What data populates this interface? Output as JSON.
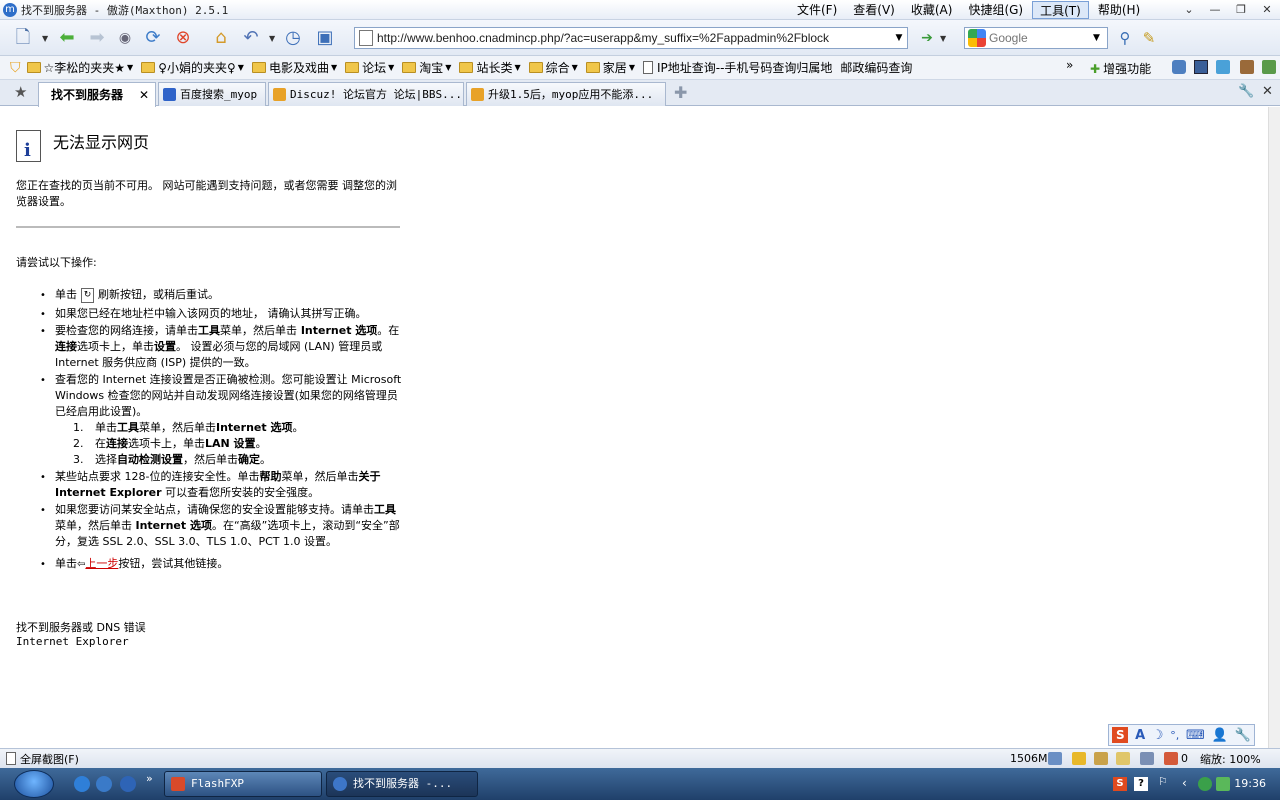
{
  "window": {
    "title": "找不到服务器 - 傲游(Maxthon) 2.5.1",
    "menu": [
      "文件(F)",
      "查看(V)",
      "收藏(A)",
      "快捷组(G)",
      "工具(T)",
      "帮助(H)"
    ],
    "active_menu": "工具(T)"
  },
  "toolbar": {
    "address": "http://www.benhoo.cnadmincp.php/?ac=userapp&my_suffix=%2Fappadmin%2Fblock",
    "search_placeholder": "Google"
  },
  "favorites": [
    {
      "label": "☆李松的夹夹★",
      "type": "folder"
    },
    {
      "label": "♀小娟的夹夹♀",
      "type": "folder"
    },
    {
      "label": "电影及戏曲",
      "type": "folder"
    },
    {
      "label": "论坛",
      "type": "folder"
    },
    {
      "label": "淘宝",
      "type": "folder"
    },
    {
      "label": "站长类",
      "type": "folder"
    },
    {
      "label": "综合",
      "type": "folder"
    },
    {
      "label": "家居",
      "type": "folder"
    },
    {
      "label": "IP地址查询--手机号码查询归属地",
      "type": "page"
    },
    {
      "label": "邮政编码查询",
      "type": "link"
    }
  ],
  "favorites_right": {
    "enhance": "增强功能"
  },
  "tabs": [
    {
      "label": "找不到服务器",
      "active": true
    },
    {
      "label": "百度搜索_myop",
      "active": false
    },
    {
      "label": "Discuz! 论坛官方 论坛|BBS...",
      "active": false
    },
    {
      "label": "升级1.5后，myop应用不能添...",
      "active": false
    }
  ],
  "page": {
    "title": "无法显示网页",
    "description": "您正在查找的页当前不可用。 网站可能遇到支持问题，或者您需要 调整您的浏览器设置。",
    "try_title": "请尝试以下操作:",
    "step1_prefix": "单击",
    "step1_suffix": "刷新按钮，或稍后重试。",
    "step2": "如果您已经在地址栏中输入该网页的地址， 请确认其拼写正确。",
    "step3_a": "要检查您的网络连接，请单击",
    "step3_b": "工具",
    "step3_c": "菜单，然后单击",
    "step3_d": " Internet 选项",
    "step3_e": "。在",
    "step3_f": "连接",
    "step3_g": "选项卡上，单击",
    "step3_h": "设置",
    "step3_i": "。 设置必须与您的局域网 (LAN) 管理员或 Internet 服务供应商 (ISP) 提供的一致。",
    "step4": "查看您的 Internet 连接设置是否正确被检测。您可能设置让 Microsoft Windows 检查您的网站并自动发现网络连接设置(如果您的网络管理员已经启用此设置)。",
    "sub_steps": [
      {
        "num": "1.",
        "a": "单击",
        "b": "工具",
        "c": "菜单，然后单击",
        "d": "Internet 选项",
        "e": "。"
      },
      {
        "num": "2.",
        "a": "在",
        "b": "连接",
        "c": "选项卡上，单击",
        "d": "LAN 设置",
        "e": "。"
      },
      {
        "num": "3.",
        "a": "选择",
        "b": "自动检测设置",
        "c": "，然后单击",
        "d": "确定",
        "e": "。"
      }
    ],
    "step5_a": "某些站点要求 128-位的连接安全性。单击",
    "step5_b": "帮助",
    "step5_c": "菜单，然后单击",
    "step5_d": "关于 Internet Explorer",
    "step5_e": " 可以查看您所安装的安全强度。",
    "step6_a": "如果您要访问某安全站点，请确保您的安全设置能够支持。请单击",
    "step6_b": "工具",
    "step6_c": "菜单，然后单击 ",
    "step6_d": "Internet 选项",
    "step6_e": "。在“高级”选项卡上，滚动到“安全”部分，复选 SSL 2.0、SSL 3.0、TLS 1.0、PCT 1.0 设置。",
    "step7_a": "单击",
    "step7_link": "上一步",
    "step7_b": "按钮，尝试其他链接。",
    "footer_error": "找不到服务器或 DNS 错误",
    "footer_app": "Internet Explorer"
  },
  "statusbar": {
    "left": "全屏截图(F)",
    "memory": "1506M",
    "popup_count": "0",
    "zoom": "缩放: 100%"
  },
  "taskbar": {
    "tasks": [
      "FlashFXP",
      "找不到服务器 -..."
    ],
    "clock": "19:36"
  }
}
